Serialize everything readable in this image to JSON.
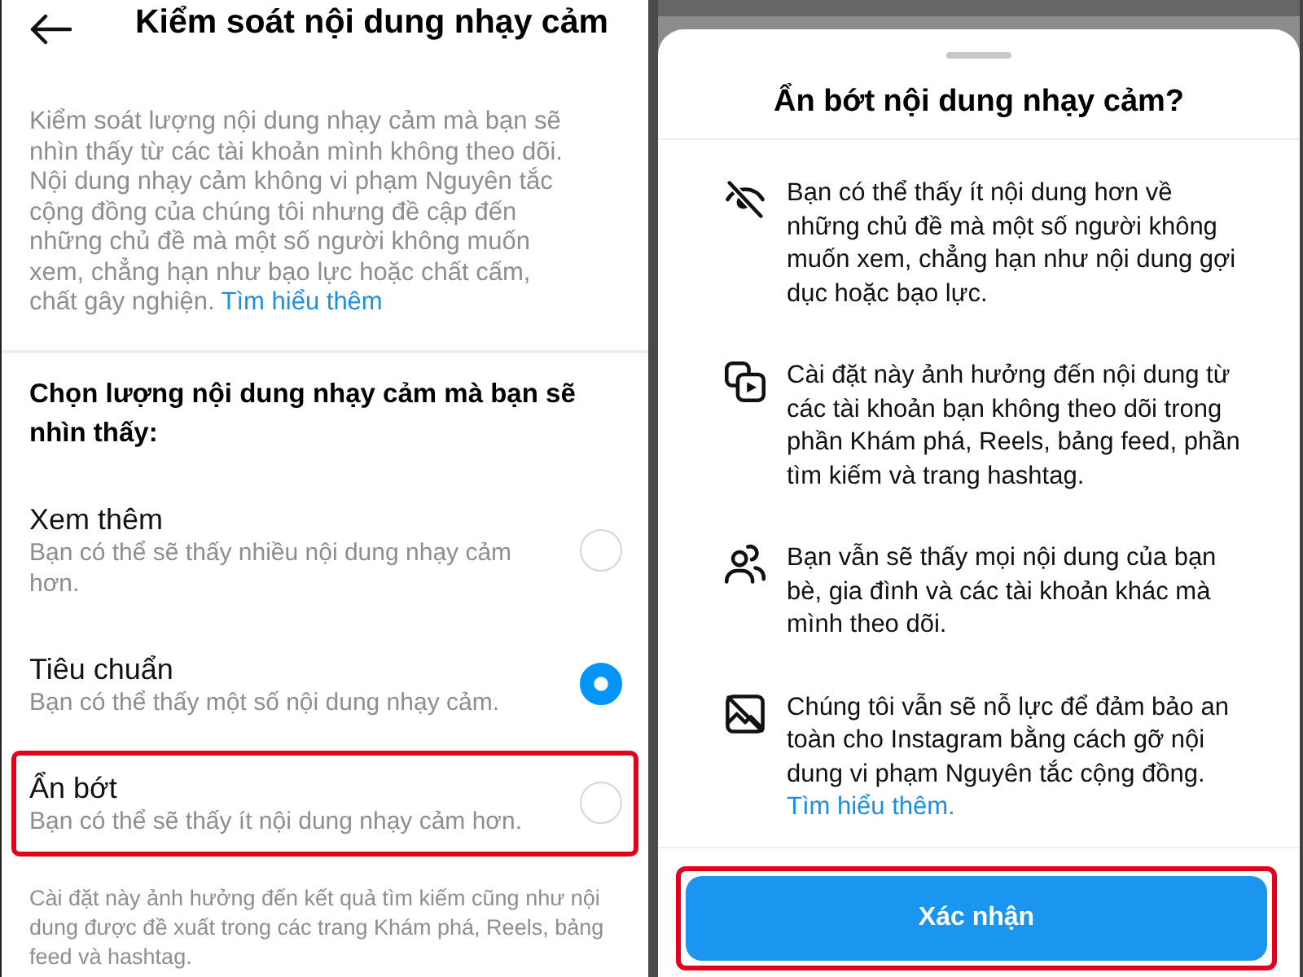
{
  "left_screen": {
    "header": {
      "title": "Kiểm soát nội dung nhạy cảm"
    },
    "description": {
      "text": "Kiểm soát lượng nội dung nhạy cảm mà bạn sẽ nhìn thấy từ các tài khoản mình không theo dõi. Nội dung nhạy cảm không vi phạm Nguyên tắc cộng đồng của chúng tôi nhưng đề cập đến những chủ đề mà một số người không muốn xem, chẳng hạn như bạo lực hoặc chất cấm, chất gây nghiện.",
      "link": "Tìm hiểu thêm"
    },
    "section_heading": "Chọn lượng nội dung nhạy cảm mà bạn sẽ nhìn thấy:",
    "options": [
      {
        "label": "Xem thêm",
        "description": "Bạn có thể sẽ thấy nhiều nội dung nhạy cảm hơn.",
        "selected": false,
        "highlighted": false
      },
      {
        "label": "Tiêu chuẩn",
        "description": "Bạn có thể thấy một số nội dung nhạy cảm.",
        "selected": true,
        "highlighted": false
      },
      {
        "label": "Ẩn bớt",
        "description": "Bạn có thể sẽ thấy ít nội dung nhạy cảm hơn.",
        "selected": false,
        "highlighted": true
      }
    ],
    "footnote": "Cài đặt này ảnh hưởng đến kết quả tìm kiếm cũng như nội dung được đề xuất trong các trang Khám phá, Reels, bảng feed và hashtag."
  },
  "right_screen": {
    "sheet": {
      "title": "Ẩn bớt nội dung nhạy cảm?",
      "items": [
        {
          "kind": "eye-off",
          "text": "Bạn có thể thấy ít nội dung hơn về những chủ đề mà một số người không muốn xem, chẳng hạn như nội dung gợi dục hoặc bạo lực."
        },
        {
          "kind": "media",
          "text": "Cài đặt này ảnh hưởng đến nội dung từ các tài khoản bạn không theo dõi trong phần Khám phá, Reels, bảng feed, phần tìm kiếm và trang hashtag."
        },
        {
          "kind": "people",
          "text": "Bạn vẫn sẽ thấy mọi nội dung của bạn bè, gia đình và các tài khoản khác mà mình theo dõi."
        },
        {
          "kind": "image-off",
          "text": "Chúng tôi vẫn sẽ nỗ lực để đảm bảo an toàn cho Instagram bằng cách gỡ nội dung vi phạm Nguyên tắc cộng đồng.",
          "link": "Tìm hiểu thêm."
        }
      ],
      "confirm_button": {
        "label": "Xác nhận",
        "highlighted": true
      }
    }
  }
}
